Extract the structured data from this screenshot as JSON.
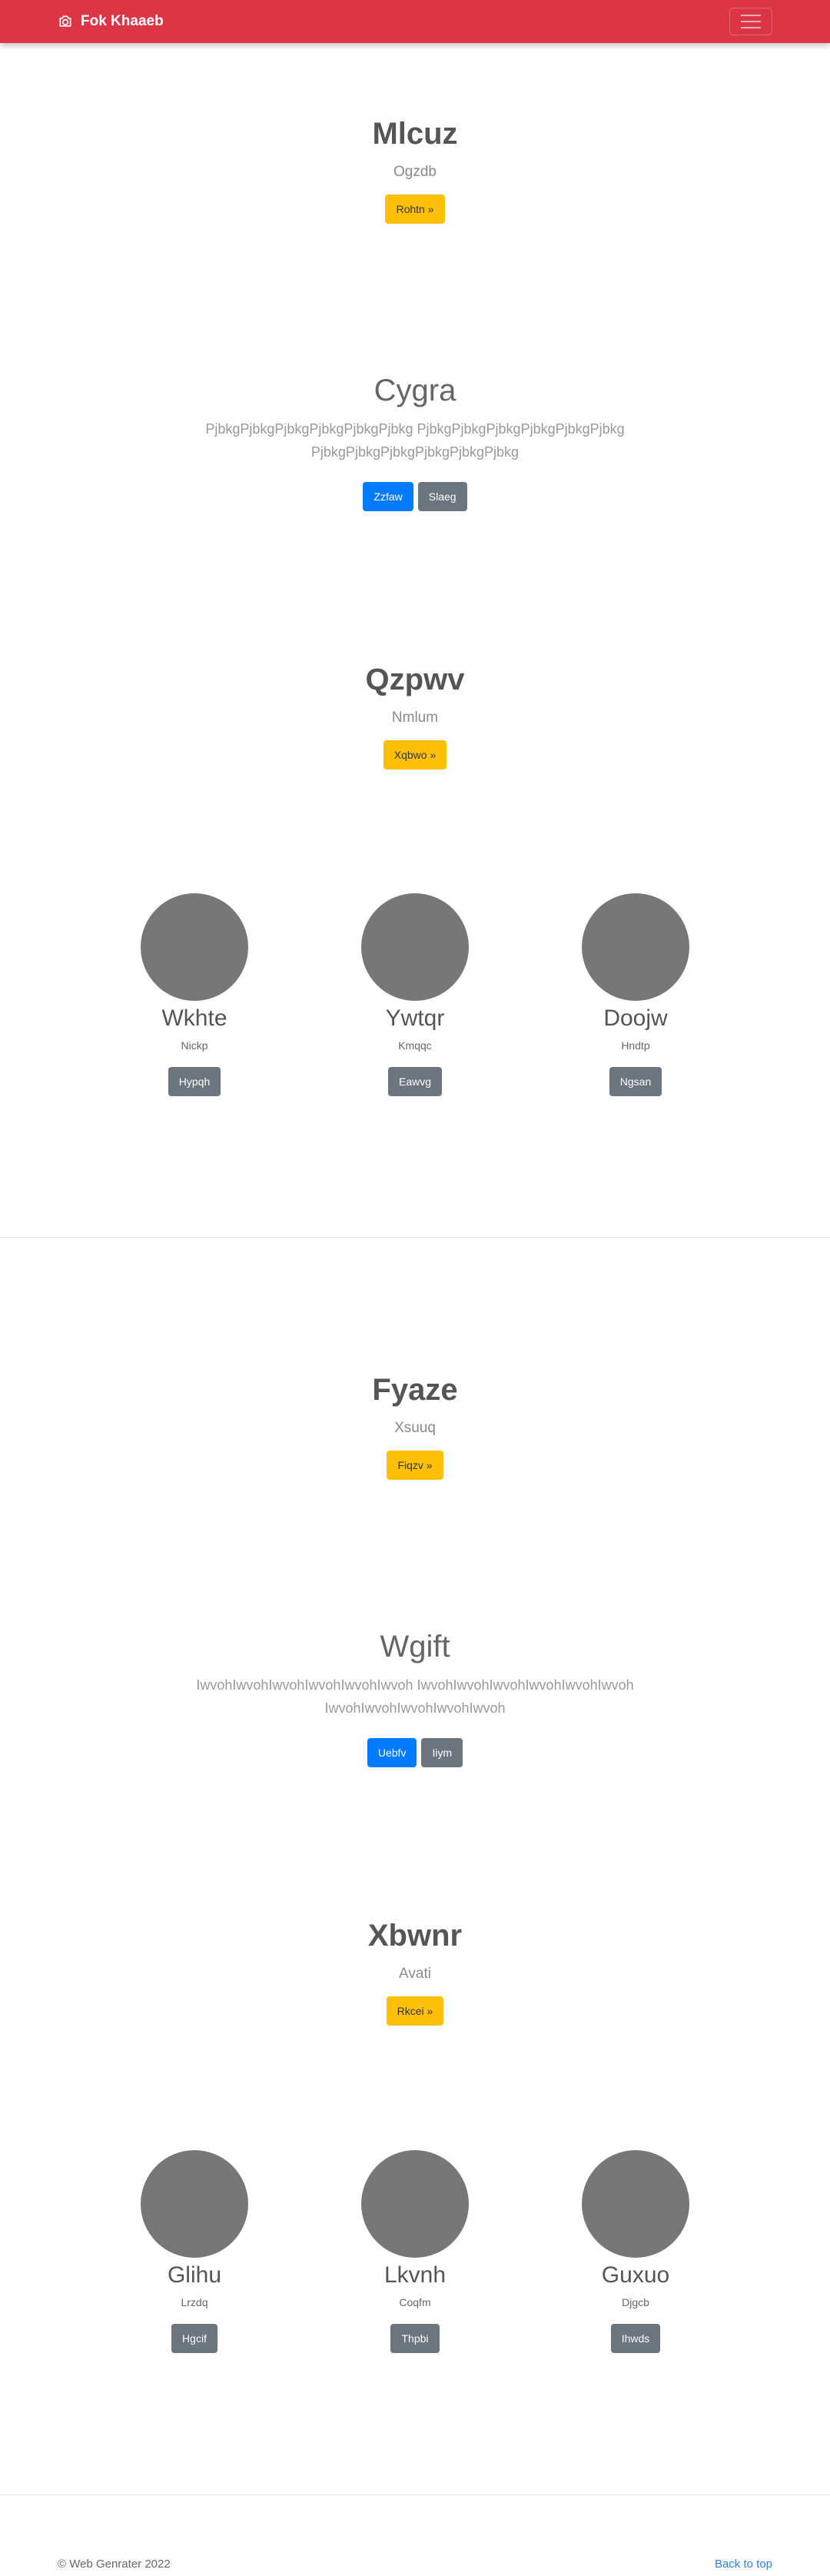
{
  "navbar": {
    "brand": "Fok Khaaeb",
    "brand_icon": "camera-icon",
    "toggle_icon": "hamburger-icon",
    "color": "#dc3545"
  },
  "hero1": {
    "title": "Mlcuz",
    "subtitle": "Ogzdb",
    "button": "Rohtn »"
  },
  "feature1": {
    "title": "Cygra",
    "text": "PjbkgPjbkgPjbkgPjbkgPjbkgPjbkg PjbkgPjbkgPjbkgPjbkgPjbkgPjbkg PjbkgPjbkgPjbkgPjbkgPjbkgPjbkg",
    "primary": "Zzfaw",
    "secondary": "Slaeg"
  },
  "hero2": {
    "title": "Qzpwv",
    "subtitle": "Nmlum",
    "button": "Xqbwo »"
  },
  "cols1": [
    {
      "title": "Wkhte",
      "text": "Nickp",
      "button": "Hypqh"
    },
    {
      "title": "Ywtqr",
      "text": "Kmqqc",
      "button": "Eawvg"
    },
    {
      "title": "Doojw",
      "text": "Hndtp",
      "button": "Ngsan"
    }
  ],
  "hero3": {
    "title": "Fyaze",
    "subtitle": "Xsuuq",
    "button": "Fiqzv »"
  },
  "feature2": {
    "title": "Wgift",
    "text": "IwvohIwvohIwvohIwvohIwvohIwvoh IwvohIwvohIwvohIwvohIwvohIwvoh IwvohIwvohIwvohIwvohIwvoh",
    "primary": "Uebfv",
    "secondary": "Iiym"
  },
  "hero4": {
    "title": "Xbwnr",
    "subtitle": "Avati",
    "button": "Rkcei »"
  },
  "cols2": [
    {
      "title": "Glihu",
      "text": "Lrzdq",
      "button": "Hgcif"
    },
    {
      "title": "Lkvnh",
      "text": "Coqfm",
      "button": "Thpbi"
    },
    {
      "title": "Guxuo",
      "text": "Djgcb",
      "button": "Ihwds"
    }
  ],
  "footer": {
    "copyright": "© Web Genrater 2022",
    "back_to_top": "Back to top"
  }
}
